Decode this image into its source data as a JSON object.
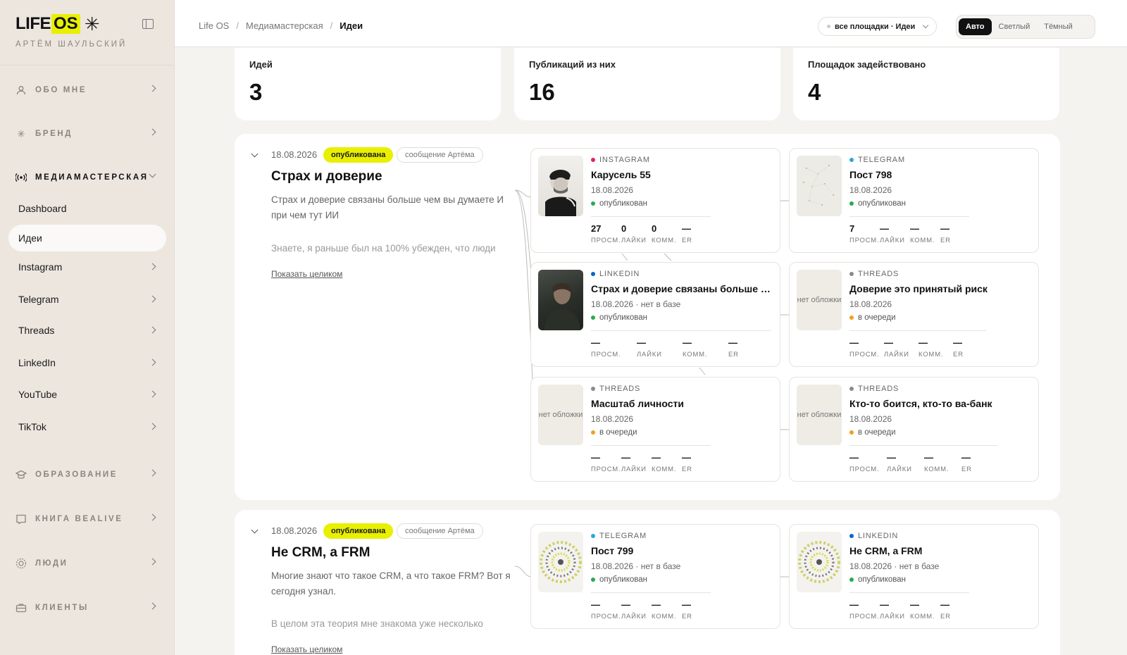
{
  "brand": {
    "life": "LIFE",
    "os": "OS",
    "star": "✳",
    "owner": "АРТЁМ ШАУЛЬСКИЙ"
  },
  "sidebar": {
    "sections": [
      {
        "label": "ОБО МНЕ",
        "icon": "user-icon"
      },
      {
        "label": "БРЕНД",
        "icon": "asterisk-icon"
      },
      {
        "label": "МЕДИАМАСТЕРСКАЯ",
        "icon": "broadcast-icon"
      },
      {
        "label": "ОБРАЗОВАНИЕ",
        "icon": "graduation-cap-icon"
      },
      {
        "label": "КНИГА BEALIVE",
        "icon": "book-icon"
      },
      {
        "label": "ЛЮДИ",
        "icon": "people-icon"
      },
      {
        "label": "КЛИЕНТЫ",
        "icon": "briefcase-icon"
      }
    ],
    "media_items": [
      "Dashboard",
      "Идеи",
      "Instagram",
      "Telegram",
      "Threads",
      "LinkedIn",
      "YouTube",
      "TikTok"
    ]
  },
  "breadcrumb": [
    "Life OS",
    "Медиамастерская",
    "Идеи"
  ],
  "filter": {
    "label": "все площадки · Идеи"
  },
  "theme": [
    "Авто",
    "Светлый",
    "Тёмный"
  ],
  "stats": [
    {
      "label": "Идей",
      "value": "3"
    },
    {
      "label": "Публикаций из них",
      "value": "16"
    },
    {
      "label": "Площадок задействовано",
      "value": "4"
    }
  ],
  "metric_labels": [
    "ПРОСМ.",
    "ЛАЙКИ",
    "КОММ.",
    "ER"
  ],
  "colors": {
    "accent": "#e8f000",
    "instagram": "#e0245e",
    "telegram": "#2ea6d9",
    "linkedin": "#0a66c2",
    "threads": "#8a8a8a",
    "published": "#2fa84f",
    "queued": "#f0a020"
  },
  "ideas": [
    {
      "date": "18.08.2026",
      "status": "опубликована",
      "source": "сообщение Артёма",
      "title": "Страх и доверие",
      "desc": "Страх и доверие связаны больше чем вы думаете И при чем тут ИИ",
      "excerpt": "Знаете, я раньше был на 100% убежден, что люди",
      "show_all": "Показать целиком",
      "pubs": [
        {
          "platform": "INSTAGRAM",
          "title": "Карусель 55",
          "date": "18.08.2026",
          "status": "опубликован",
          "metrics": [
            "27",
            "0",
            "0",
            "—"
          ]
        },
        {
          "platform": "TELEGRAM",
          "title": "Пост 798",
          "date": "18.08.2026",
          "status": "опубликован",
          "metrics": [
            "7",
            "—",
            "—",
            "—"
          ]
        },
        {
          "platform": "LINKEDIN",
          "title": "Страх и доверие связаны больше ч...",
          "date": "18.08.2026 · нет в базе",
          "status": "опубликован",
          "metrics": [
            "—",
            "—",
            "—",
            "—"
          ]
        },
        {
          "platform": "THREADS",
          "title": "Доверие это принятый риск",
          "date": "18.08.2026",
          "status": "в очереди",
          "metrics": [
            "—",
            "—",
            "—",
            "—"
          ],
          "nocover": "нет обложки"
        },
        {
          "platform": "THREADS",
          "title": "Масштаб личности",
          "date": "18.08.2026",
          "status": "в очереди",
          "metrics": [
            "—",
            "—",
            "—",
            "—"
          ],
          "nocover": "нет обложки"
        },
        {
          "platform": "THREADS",
          "title": "Кто-то боится, кто-то ва-банк",
          "date": "18.08.2026",
          "status": "в очереди",
          "metrics": [
            "—",
            "—",
            "—",
            "—"
          ],
          "nocover": "нет обложки"
        }
      ]
    },
    {
      "date": "18.08.2026",
      "status": "опубликована",
      "source": "сообщение Артёма",
      "title": "Не CRM, а FRM",
      "desc": "Многие знают что такое CRM, а что такое FRM? Вот я сегодня узнал.",
      "excerpt": "В целом эта теория мне знакома уже несколько",
      "show_all": "Показать целиком",
      "pubs": [
        {
          "platform": "TELEGRAM",
          "title": "Пост 799",
          "date": "18.08.2026 · нет в базе",
          "status": "опубликован",
          "metrics": [
            "—",
            "—",
            "—",
            "—"
          ]
        },
        {
          "platform": "LINKEDIN",
          "title": "Не CRM, а FRM",
          "date": "18.08.2026 · нет в базе",
          "status": "опубликован",
          "metrics": [
            "—",
            "—",
            "—",
            "—"
          ]
        }
      ]
    }
  ]
}
